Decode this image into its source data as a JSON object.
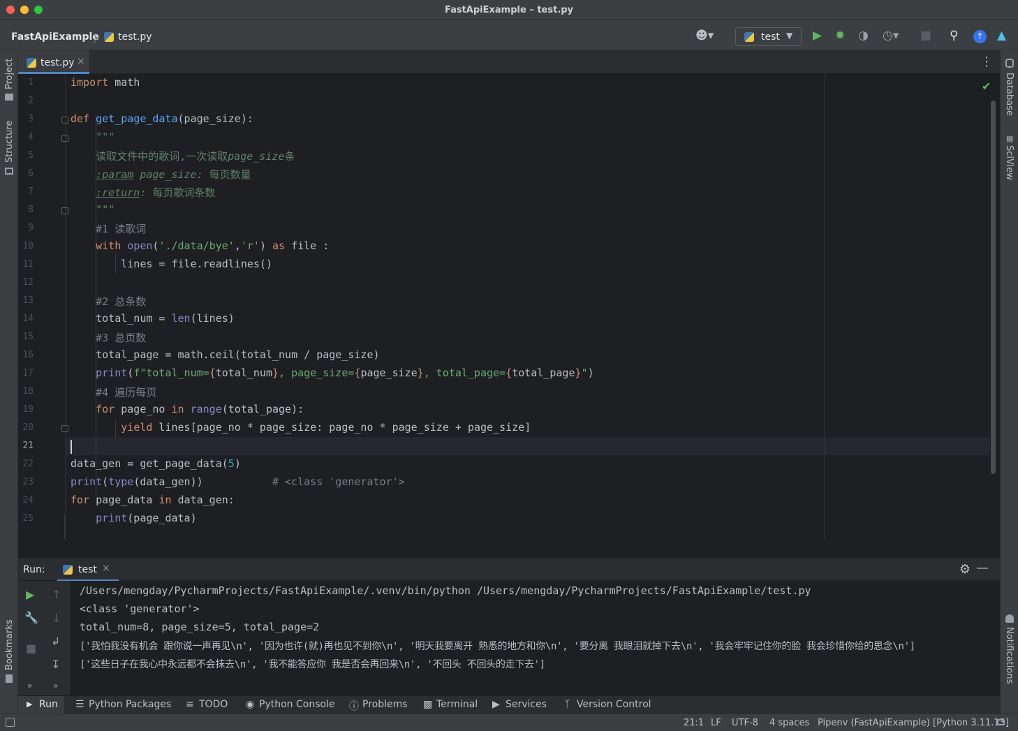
{
  "window": {
    "title": "FastApiExample – test.py"
  },
  "colors": {
    "close": "#ff5f57",
    "minimize": "#febc2e",
    "zoom": "#28c840",
    "accent": "#4a88c7",
    "run_green": "#5fb85f"
  },
  "breadcrumb": {
    "project": "FastApiExample",
    "separator": "〉",
    "file": "test.py"
  },
  "toolbar": {
    "run_config": "test",
    "icons": [
      "user-icon",
      "run-icon",
      "debug-icon",
      "coverage-icon",
      "profile-icon",
      "stop-icon",
      "search-icon",
      "update-icon",
      "plugin-icon"
    ]
  },
  "left_strip": {
    "project": "Project",
    "structure": "Structure",
    "bookmarks": "Bookmarks"
  },
  "right_strip": {
    "database": "Database",
    "sciview": "SciView",
    "notifications": "Notifications"
  },
  "editor": {
    "tab": "test.py",
    "line_numbers": [
      "1",
      "2",
      "3",
      "4",
      "5",
      "6",
      "7",
      "8",
      "9",
      "10",
      "11",
      "12",
      "13",
      "14",
      "15",
      "16",
      "17",
      "18",
      "19",
      "20",
      "21",
      "22",
      "23",
      "24",
      "25"
    ],
    "current_line": "21",
    "lines": [
      [
        [
          "kw",
          "import"
        ],
        [
          "p",
          " math"
        ]
      ],
      [],
      [
        [
          "kw",
          "def"
        ],
        [
          "p",
          " "
        ],
        [
          "fn",
          "get_page_data"
        ],
        [
          "p",
          "(page_size):"
        ]
      ],
      [
        [
          "doc",
          "    \"\"\""
        ]
      ],
      [
        [
          "doc",
          "    读取文件中的歌词,一次读取"
        ],
        [
          "docit",
          "page_size"
        ],
        [
          "doc",
          "条"
        ]
      ],
      [
        [
          "p",
          "    "
        ],
        [
          "doctag",
          ":param"
        ],
        [
          "docit",
          " page_size:"
        ],
        [
          "doc",
          " 每页数量"
        ]
      ],
      [
        [
          "p",
          "    "
        ],
        [
          "doctag",
          ":return"
        ],
        [
          "docit",
          ":"
        ],
        [
          "doc",
          " 每页歌词条数"
        ]
      ],
      [
        [
          "doc",
          "    \"\"\""
        ]
      ],
      [
        [
          "cmt",
          "    #1 读歌词"
        ]
      ],
      [
        [
          "p",
          "    "
        ],
        [
          "kw",
          "with"
        ],
        [
          "p",
          " "
        ],
        [
          "bi",
          "open"
        ],
        [
          "p",
          "("
        ],
        [
          "str",
          "'./data/bye'"
        ],
        [
          "p",
          ","
        ],
        [
          "str",
          "'r'"
        ],
        [
          "p",
          ") "
        ],
        [
          "kw",
          "as"
        ],
        [
          "p",
          " file :"
        ]
      ],
      [
        [
          "p",
          "        lines = file.readlines()"
        ]
      ],
      [],
      [
        [
          "cmt",
          "    #2 总条数"
        ]
      ],
      [
        [
          "p",
          "    total_num = "
        ],
        [
          "bi",
          "len"
        ],
        [
          "p",
          "(lines)"
        ]
      ],
      [
        [
          "cmt",
          "    #3 总页数"
        ]
      ],
      [
        [
          "p",
          "    total_page = math.ceil(total_num / page_size)"
        ]
      ],
      [
        [
          "p",
          "    "
        ],
        [
          "bi",
          "print"
        ],
        [
          "p",
          "("
        ],
        [
          "str",
          "f\"total_num="
        ],
        [
          "fstr",
          "{"
        ],
        [
          "p",
          "total_num"
        ],
        [
          "fstr",
          "}"
        ],
        [
          "str",
          ", page_size="
        ],
        [
          "fstr",
          "{"
        ],
        [
          "p",
          "page_size"
        ],
        [
          "fstr",
          "}"
        ],
        [
          "str",
          ", total_page="
        ],
        [
          "fstr",
          "{"
        ],
        [
          "p",
          "total_page"
        ],
        [
          "fstr",
          "}"
        ],
        [
          "str",
          "\""
        ],
        [
          "p",
          ")"
        ]
      ],
      [
        [
          "cmt",
          "    #4 遍历每页"
        ]
      ],
      [
        [
          "p",
          "    "
        ],
        [
          "kw",
          "for"
        ],
        [
          "p",
          " page_no "
        ],
        [
          "kw",
          "in"
        ],
        [
          "p",
          " "
        ],
        [
          "bi",
          "range"
        ],
        [
          "p",
          "(total_page):"
        ]
      ],
      [
        [
          "p",
          "        "
        ],
        [
          "kw",
          "yield"
        ],
        [
          "p",
          " lines[page_no * page_size: page_no * page_size + page_size]"
        ]
      ],
      [],
      [
        [
          "p",
          "data_gen = get_page_data("
        ],
        [
          "num",
          "5"
        ],
        [
          "p",
          ")"
        ]
      ],
      [
        [
          "bi",
          "print"
        ],
        [
          "p",
          "("
        ],
        [
          "bi",
          "type"
        ],
        [
          "p",
          "(data_gen))           "
        ],
        [
          "cmt",
          "# <class 'generator'>"
        ]
      ],
      [
        [
          "kw",
          "for"
        ],
        [
          "p",
          " page_data "
        ],
        [
          "kw",
          "in"
        ],
        [
          "p",
          " data_gen:"
        ]
      ],
      [
        [
          "p",
          "    "
        ],
        [
          "bi",
          "print"
        ],
        [
          "p",
          "(page_data)"
        ]
      ]
    ]
  },
  "run_panel": {
    "label": "Run:",
    "tab": "test",
    "output": [
      "/Users/mengday/PycharmProjects/FastApiExample/.venv/bin/python /Users/mengday/PycharmProjects/FastApiExample/test.py",
      "<class 'generator'>",
      "total_num=8, page_size=5, total_page=2",
      "['我怕我没有机会 跟你说一声再见\\n', '因为也许(就)再也见不到你\\n', '明天我要离开 熟悉的地方和你\\n', '要分离 我眼泪就掉下去\\n', '我会牢牢记住你的脸 我会珍惜你给的思念\\n']",
      "['这些日子在我心中永远都不会抹去\\n', '我不能答应你 我是否会再回来\\n', '不回头 不回头的走下去']"
    ]
  },
  "bottom_tabs": {
    "run": "Run",
    "python_packages": "Python Packages",
    "todo": "TODO",
    "python_console": "Python Console",
    "problems": "Problems",
    "terminal": "Terminal",
    "services": "Services",
    "version_control": "Version Control"
  },
  "status": {
    "position": "21:1",
    "line_sep": "LF",
    "encoding": "UTF-8",
    "indent": "4 spaces",
    "interpreter": "Pipenv (FastApiExample) [Python 3.11.13]"
  }
}
